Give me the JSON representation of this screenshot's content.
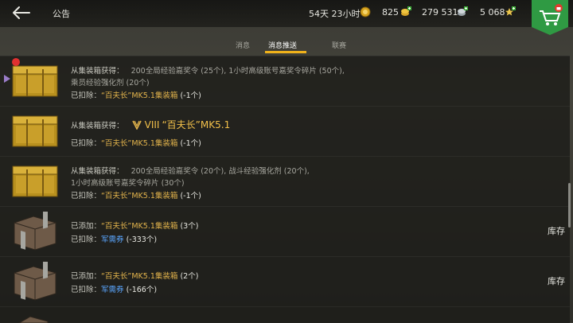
{
  "header": {
    "title": "公告",
    "time_left": "54天 23小时",
    "gold": "825",
    "silver": "279 531",
    "free_xp": "5 068"
  },
  "tabs": [
    {
      "label": "消息",
      "active": false
    },
    {
      "label": "消息推送",
      "active": true
    },
    {
      "label": "联赛",
      "active": false
    }
  ],
  "rows": [
    {
      "icon": "gold-crate-icon",
      "line1_prefix": "从集装箱获得：",
      "line1_text": "200全局经验嘉奖令 (25个), 1小时高级账号嘉奖令碎片 (50个),",
      "line2_text": "乘员经验强化剂 (20个)",
      "line3_prefix": "已扣除：",
      "line3_item": "“百夫长”MK5.1集装箱",
      "line3_qty": "(-1个)"
    },
    {
      "icon": "gold-crate-icon",
      "line1_prefix": "从集装箱获得：",
      "tier": "VIII",
      "tank_name": "“百夫长”MK5.1",
      "line2_prefix": "已扣除：",
      "line2_item": "“百夫长”MK5.1集装箱",
      "line2_qty": "(-1个)"
    },
    {
      "icon": "gold-crate-icon",
      "line1_prefix": "从集装箱获得：",
      "line1_text": "200全局经验嘉奖令 (20个), 战斗经验强化剂 (20个),",
      "line2_text": "1小时高级账号嘉奖令碎片 (30个)",
      "line3_prefix": "已扣除：",
      "line3_item": "“百夫长”MK5.1集装箱",
      "line3_qty": "(-1个)"
    },
    {
      "icon": "steel-crate-icon",
      "line1_prefix": "已添加：",
      "line1_item": "“百夫长”MK5.1集装箱",
      "line1_qty": "(3个)",
      "line2_prefix": "已扣除：",
      "line2_item": "军需券",
      "line2_qty": "(-333个)",
      "action": "库存"
    },
    {
      "icon": "steel-crate-icon",
      "line1_prefix": "已添加：",
      "line1_item": "“百夫长”MK5.1集装箱",
      "line1_qty": "(2个)",
      "line2_prefix": "已扣除：",
      "line2_item": "军需券",
      "line2_qty": "(-166个)",
      "action": "库存"
    }
  ],
  "colors": {
    "accent": "#f0b21b",
    "gold_text": "#e3b44c",
    "blue_text": "#5aa6ff",
    "store_green": "#2f9a43"
  }
}
